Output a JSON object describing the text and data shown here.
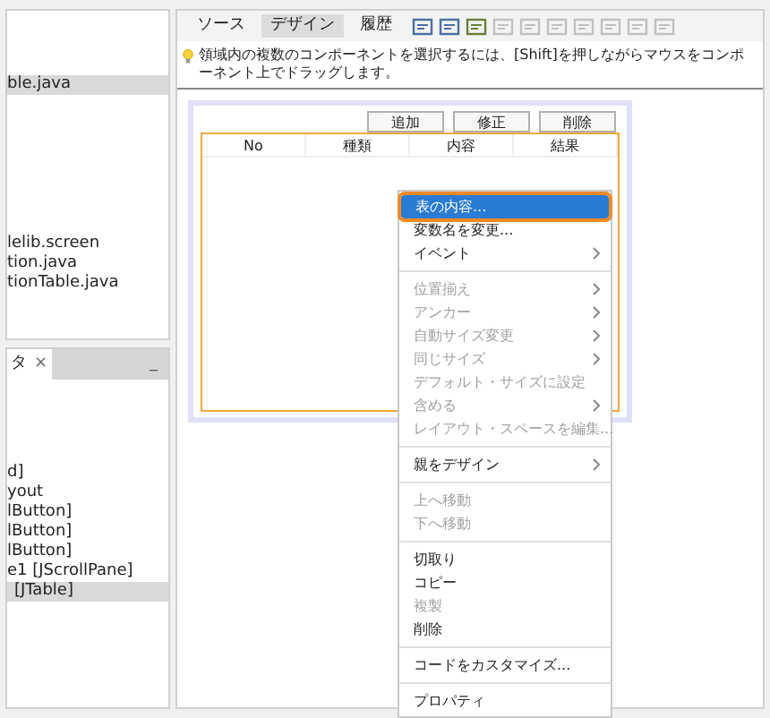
{
  "left_top_tree": [
    {
      "label": "ble.java",
      "selected": true
    },
    {
      "label": "lelib.screen",
      "selected": false
    },
    {
      "label": "tion.java",
      "selected": false
    },
    {
      "label": "tionTable.java",
      "selected": false
    }
  ],
  "left_bottom_panel": {
    "tab_label": "タ",
    "close": "×",
    "minimize": "_",
    "items": [
      {
        "label": "d]",
        "selected": false
      },
      {
        "label": "yout",
        "selected": false
      },
      {
        "label": "lButton]",
        "selected": false
      },
      {
        "label": "lButton]",
        "selected": false
      },
      {
        "label": "lButton]",
        "selected": false
      },
      {
        "label": "e1 [JScrollPane]",
        "selected": false
      },
      {
        "label": "[JTable]",
        "selected": true
      }
    ]
  },
  "editor_tabs": [
    {
      "label": "ソース",
      "selected": false
    },
    {
      "label": "デザイン",
      "selected": true
    },
    {
      "label": "履歴",
      "selected": false
    }
  ],
  "hint": "領域内の複数のコンポーネントを選択するには、[Shift]を押しながらマウスをコンポーネント上でドラッグします。",
  "design_buttons": [
    "追加",
    "修正",
    "削除"
  ],
  "table": {
    "columns": [
      "No",
      "種類",
      "内容",
      "結果"
    ]
  },
  "context_menu": [
    {
      "kind": "item",
      "label": "表の内容...",
      "selected": true,
      "disabled": false,
      "submenu": false
    },
    {
      "kind": "item",
      "label": "変数名を変更...",
      "selected": false,
      "disabled": false,
      "submenu": false
    },
    {
      "kind": "item",
      "label": "イベント",
      "selected": false,
      "disabled": false,
      "submenu": true
    },
    {
      "kind": "separator"
    },
    {
      "kind": "item",
      "label": "位置揃え",
      "selected": false,
      "disabled": true,
      "submenu": true
    },
    {
      "kind": "item",
      "label": "アンカー",
      "selected": false,
      "disabled": true,
      "submenu": true
    },
    {
      "kind": "item",
      "label": "自動サイズ変更",
      "selected": false,
      "disabled": true,
      "submenu": true
    },
    {
      "kind": "item",
      "label": "同じサイズ",
      "selected": false,
      "disabled": true,
      "submenu": true
    },
    {
      "kind": "item",
      "label": "デフォルト・サイズに設定",
      "selected": false,
      "disabled": true,
      "submenu": false
    },
    {
      "kind": "item",
      "label": "含める",
      "selected": false,
      "disabled": true,
      "submenu": true
    },
    {
      "kind": "item",
      "label": "レイアウト・スペースを編集...",
      "selected": false,
      "disabled": true,
      "submenu": false
    },
    {
      "kind": "separator"
    },
    {
      "kind": "item",
      "label": "親をデザイン",
      "selected": false,
      "disabled": false,
      "submenu": true
    },
    {
      "kind": "separator"
    },
    {
      "kind": "item",
      "label": "上へ移動",
      "selected": false,
      "disabled": true,
      "submenu": false
    },
    {
      "kind": "item",
      "label": "下へ移動",
      "selected": false,
      "disabled": true,
      "submenu": false
    },
    {
      "kind": "separator"
    },
    {
      "kind": "item",
      "label": "切取り",
      "selected": false,
      "disabled": false,
      "submenu": false
    },
    {
      "kind": "item",
      "label": "コピー",
      "selected": false,
      "disabled": false,
      "submenu": false
    },
    {
      "kind": "item",
      "label": "複製",
      "selected": false,
      "disabled": true,
      "submenu": false
    },
    {
      "kind": "item",
      "label": "削除",
      "selected": false,
      "disabled": false,
      "submenu": false
    },
    {
      "kind": "separator"
    },
    {
      "kind": "item",
      "label": "コードをカスタマイズ...",
      "selected": false,
      "disabled": false,
      "submenu": false
    },
    {
      "kind": "separator"
    },
    {
      "kind": "item",
      "label": "プロパティ",
      "selected": false,
      "disabled": false,
      "submenu": false
    }
  ]
}
